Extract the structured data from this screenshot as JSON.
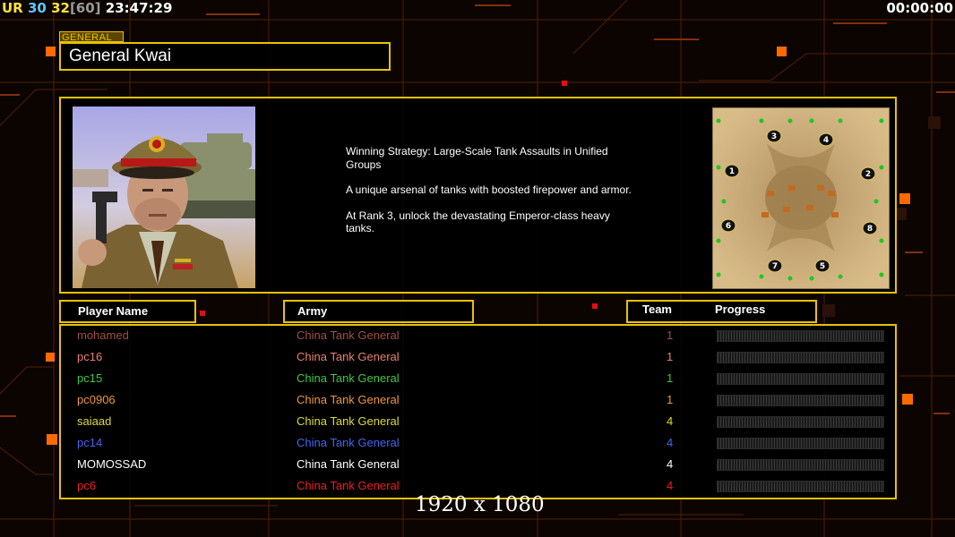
{
  "hud": {
    "ur": "UR",
    "fps": "30",
    "logic": "32",
    "cap": "[60]",
    "clock": "23:47:29",
    "timer": "00:00:00"
  },
  "general": {
    "tag": "GENERAL",
    "name": "General Kwai",
    "portrait_icon": "general-portrait",
    "description": [
      "Winning Strategy: Large-Scale Tank Assaults in Unified Groups",
      "A unique arsenal of tanks with boosted firepower and armor.",
      "At Rank 3, unlock the devastating Emperor-class heavy tanks."
    ]
  },
  "map": {
    "icon": "minimap",
    "start_positions": [
      "1",
      "2",
      "3",
      "4",
      "5",
      "6",
      "7",
      "8"
    ]
  },
  "columns": {
    "player": "Player Name",
    "army": "Army",
    "team": "Team",
    "progress": "Progress"
  },
  "players": [
    {
      "name": "mohamed",
      "army": "China Tank General",
      "team": "1",
      "color": "#a0503c"
    },
    {
      "name": "pc16",
      "army": "China Tank General",
      "team": "1",
      "color": "#e8826e"
    },
    {
      "name": "pc15",
      "army": "China Tank General",
      "team": "1",
      "color": "#3ec83e"
    },
    {
      "name": "pc0906",
      "army": "China Tank General",
      "team": "1",
      "color": "#f0963c"
    },
    {
      "name": "saiaad",
      "army": "China Tank General",
      "team": "4",
      "color": "#dcdc32"
    },
    {
      "name": "pc14",
      "army": "China Tank General",
      "team": "4",
      "color": "#4664f0"
    },
    {
      "name": "MOMOSSAD",
      "army": "China Tank General",
      "team": "4",
      "color": "#ffffff"
    },
    {
      "name": "pc6",
      "army": "China Tank General",
      "team": "4",
      "color": "#f01e1e"
    }
  ],
  "resolution": "1920 x 1080",
  "colors": {
    "accent": "#e8c200",
    "background": "#0b0401",
    "circuit": "#6a2808",
    "node": "#ff6a00"
  }
}
